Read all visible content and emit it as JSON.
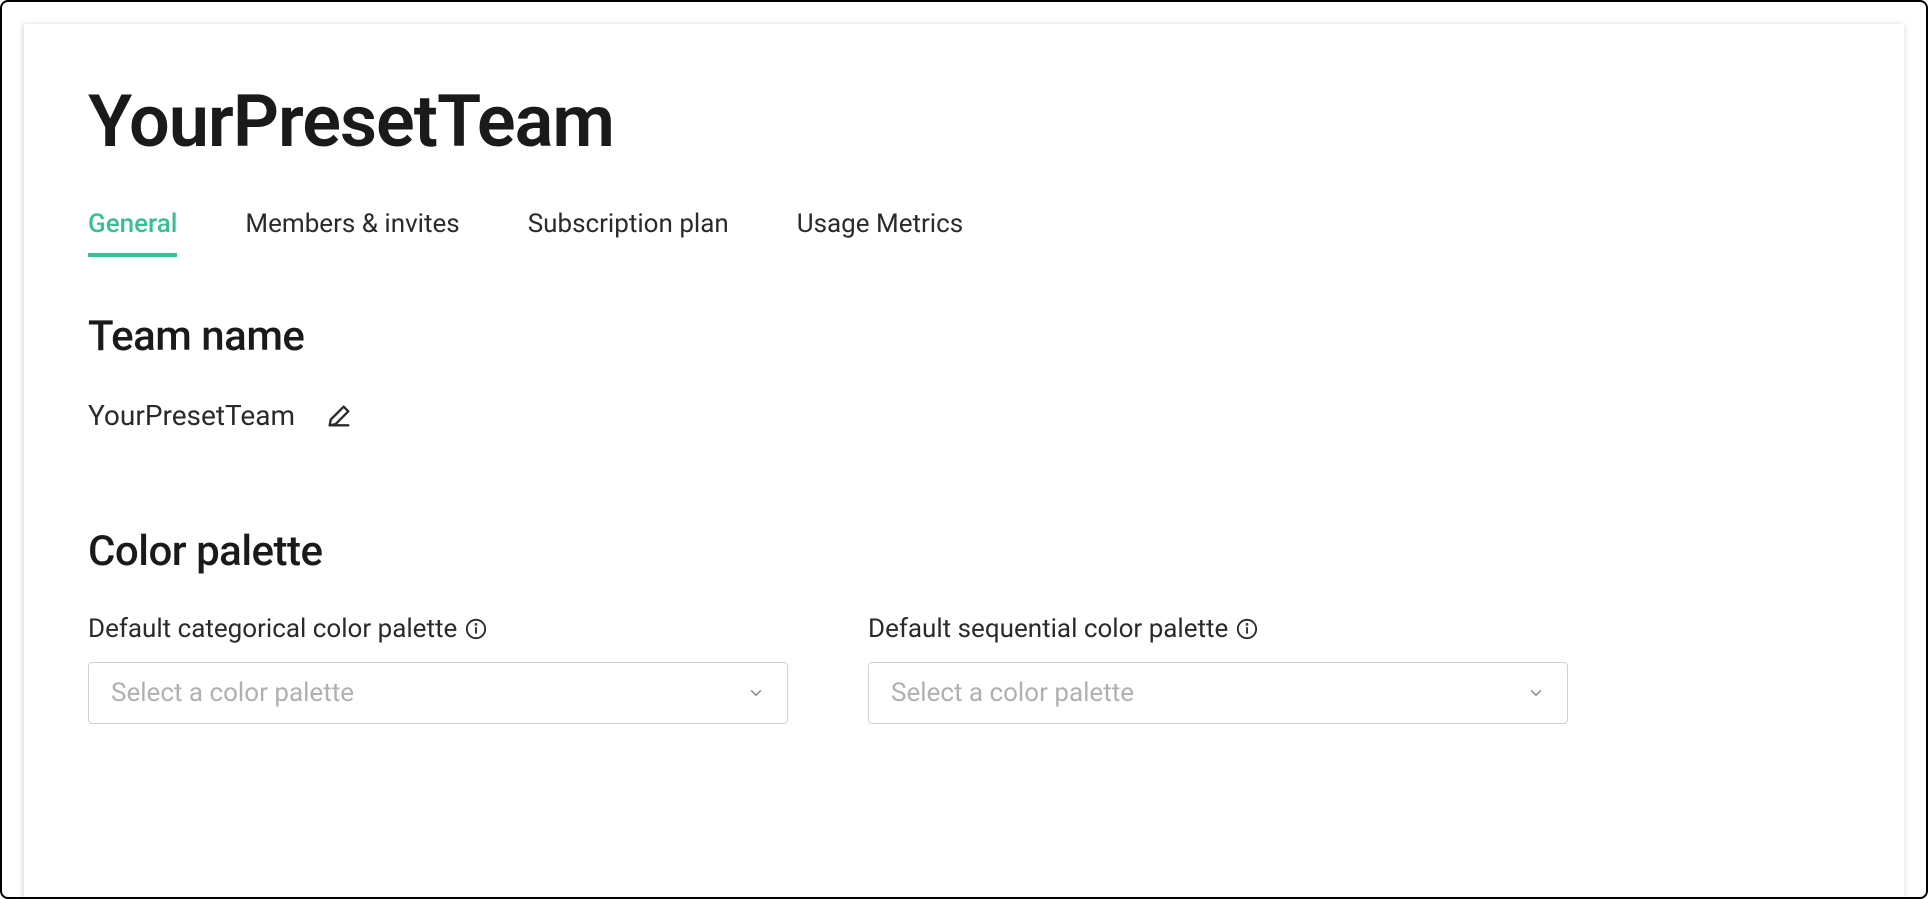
{
  "header": {
    "title": "YourPresetTeam"
  },
  "tabs": [
    {
      "label": "General",
      "active": true
    },
    {
      "label": "Members & invites",
      "active": false
    },
    {
      "label": "Subscription plan",
      "active": false
    },
    {
      "label": "Usage Metrics",
      "active": false
    }
  ],
  "sections": {
    "team_name": {
      "heading": "Team name",
      "value": "YourPresetTeam"
    },
    "color_palette": {
      "heading": "Color palette",
      "categorical": {
        "label": "Default categorical color palette",
        "placeholder": "Select a color palette"
      },
      "sequential": {
        "label": "Default sequential color palette",
        "placeholder": "Select a color palette"
      }
    }
  },
  "colors": {
    "accent": "#3bbf91"
  }
}
